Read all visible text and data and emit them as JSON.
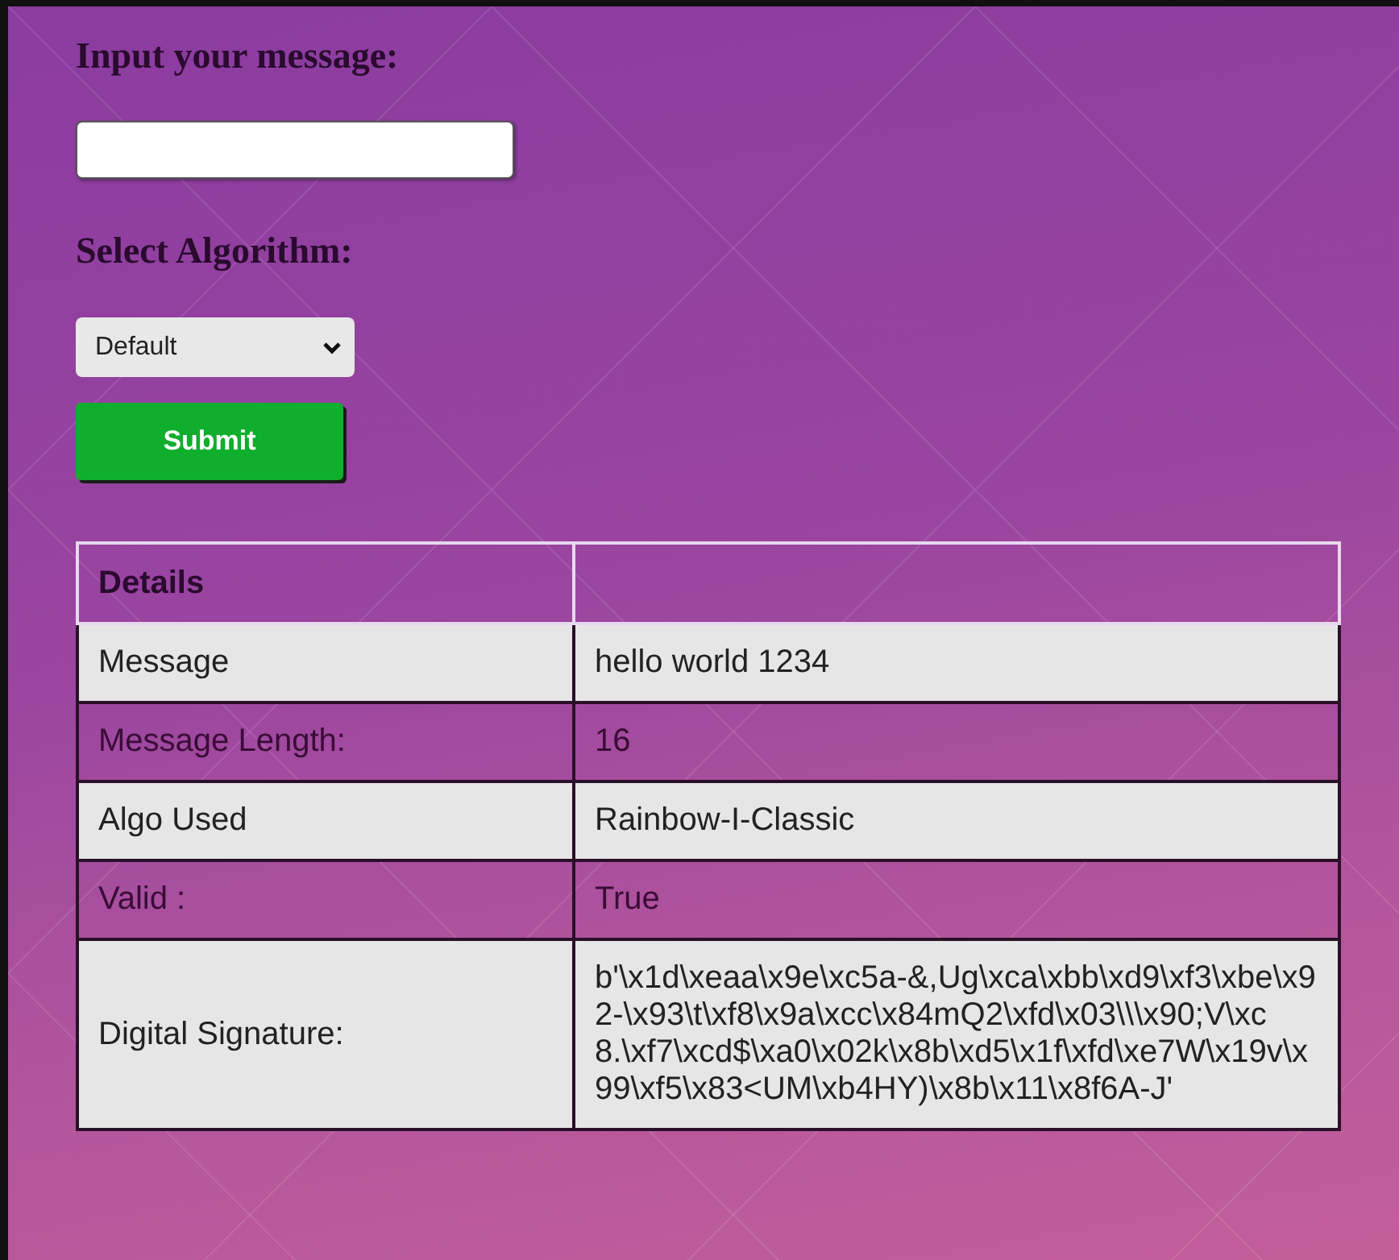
{
  "form": {
    "message_label": "Input your message:",
    "algorithm_label": "Select Algorithm:",
    "algorithm_select": {
      "value": "Default"
    },
    "submit_button": "Submit"
  },
  "details_table": {
    "header": "Details",
    "rows": [
      {
        "label": "Message",
        "value": "hello world 1234"
      },
      {
        "label": "Message Length:",
        "value": "16"
      },
      {
        "label": "Algo Used",
        "value": "Rainbow-I-Classic"
      },
      {
        "label": "Valid :",
        "value": "True"
      },
      {
        "label": "Digital Signature:",
        "value": "b'\\x1d\\xeaa\\x9e\\xc5a-&,Ug\\xca\\xbb\\xd9\\xf3\\xbe\\x92-\\x93\\t\\xf8\\x9a\\xcc\\x84mQ2\\xfd\\x03\\\\\\x90;V\\xc8.\\xf7\\xcd$\\xa0\\x02k\\x8b\\xd5\\x1f\\xfd\\xe7W\\x19v\\x99\\xf5\\x83<UM\\xb4HY)\\x8b\\x11\\x8f6A-J'"
      }
    ]
  }
}
